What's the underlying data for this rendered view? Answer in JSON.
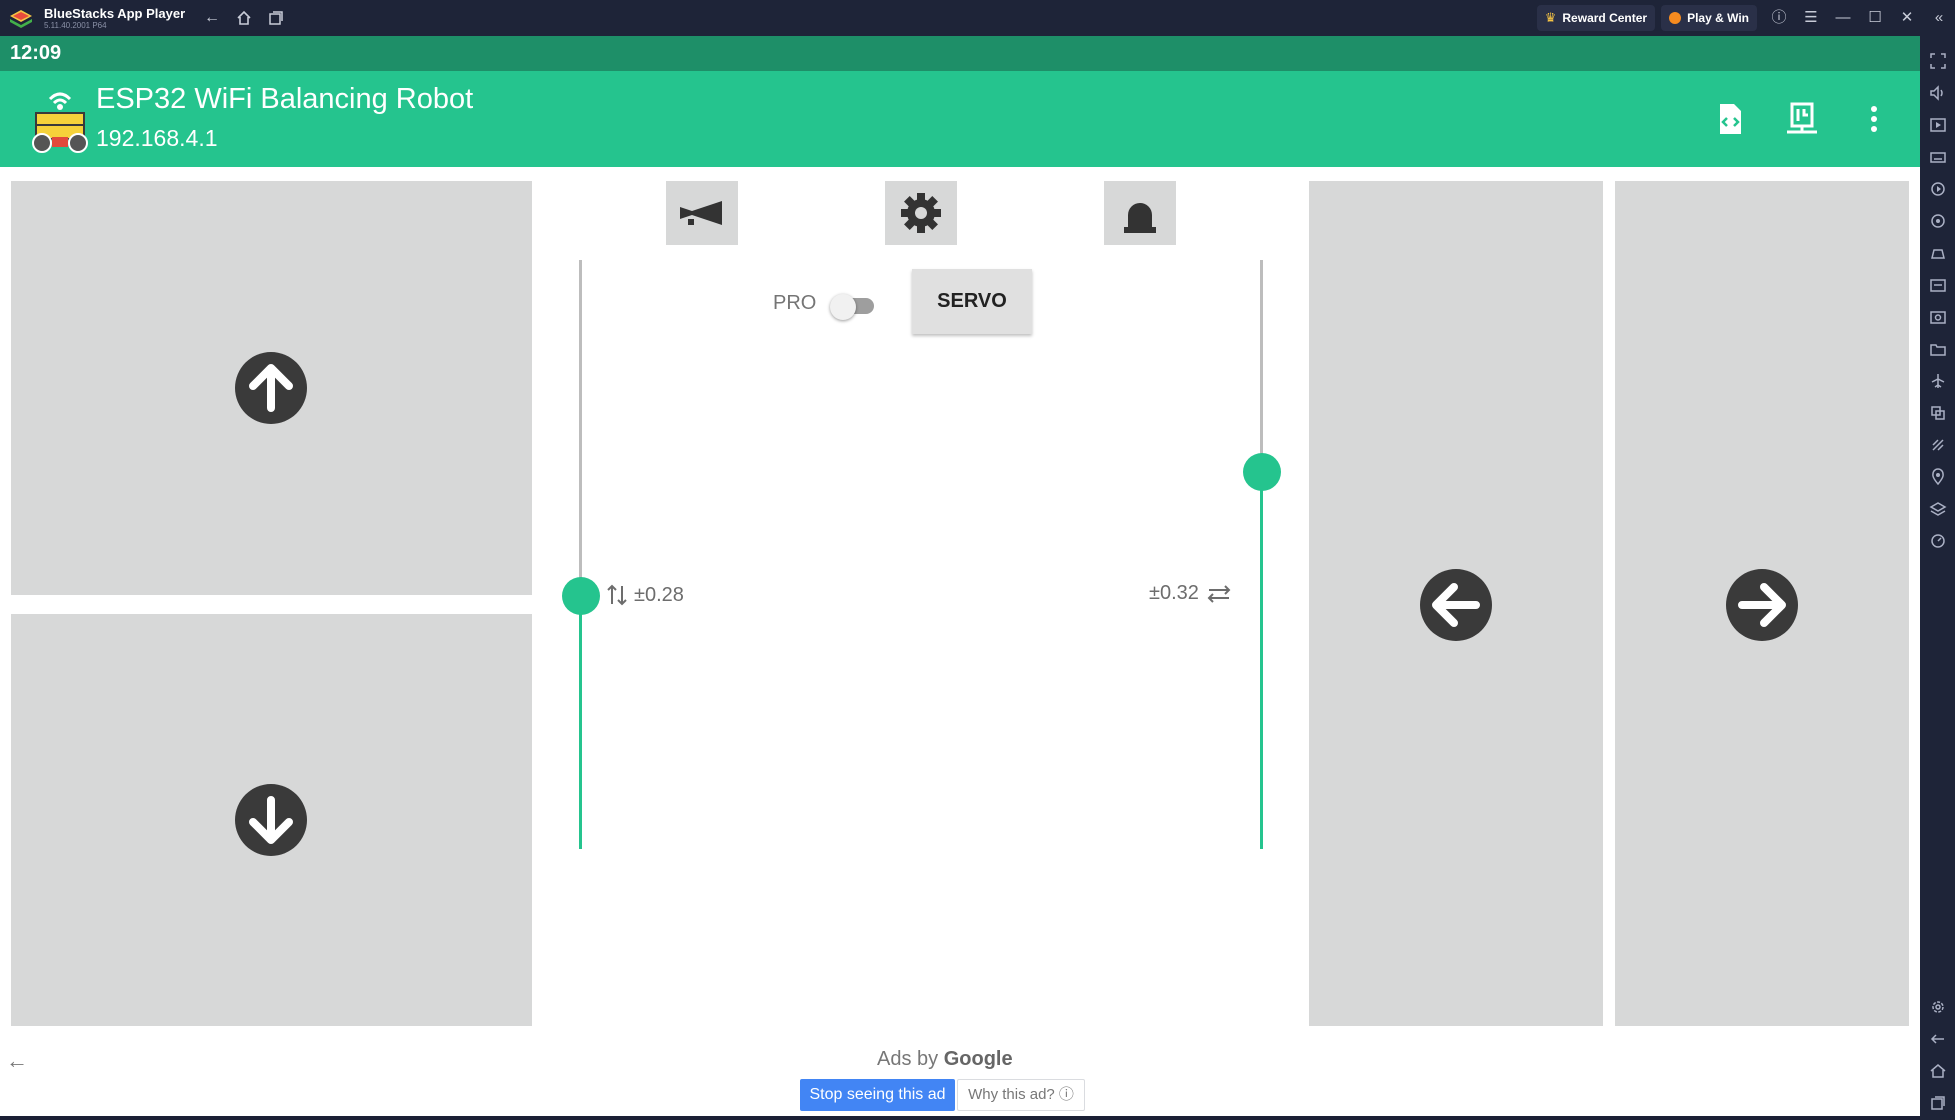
{
  "window": {
    "app_name": "BlueStacks App Player",
    "version": "5.11.40.2001 P64",
    "reward_center": "Reward Center",
    "play_win": "Play & Win"
  },
  "status": {
    "time": "12:09"
  },
  "app": {
    "title": "ESP32 WiFi Balancing Robot",
    "ip": "192.168.4.1"
  },
  "controls": {
    "pro_label": "PRO",
    "pro_enabled": false,
    "servo_label": "SERVO",
    "left_slider": {
      "readout": "±0.28",
      "level": 0.43
    },
    "right_slider": {
      "readout": "±0.32",
      "level": 0.64
    }
  },
  "ad": {
    "ads_by": "Ads by",
    "google": "Google",
    "stop_label": "Stop seeing this ad",
    "why_label": "Why this ad? ⓘ"
  },
  "colors": {
    "accent": "#25c48e",
    "status_bar": "#1e8f68",
    "pad": "#d7d8d8",
    "pad_icon": "#3a3a3a",
    "ad_button": "#4285f4"
  },
  "icons": {
    "app_logo": "robot-wifi-icon",
    "appbar_actions": [
      "code-file-icon",
      "flash-board-icon",
      "more-vert-icon"
    ],
    "top_buttons": [
      "horn-icon",
      "settings-gear-icon",
      "siren-icon"
    ],
    "pads": [
      "arrow-up-icon",
      "arrow-down-icon",
      "arrow-left-icon",
      "arrow-right-icon"
    ]
  }
}
